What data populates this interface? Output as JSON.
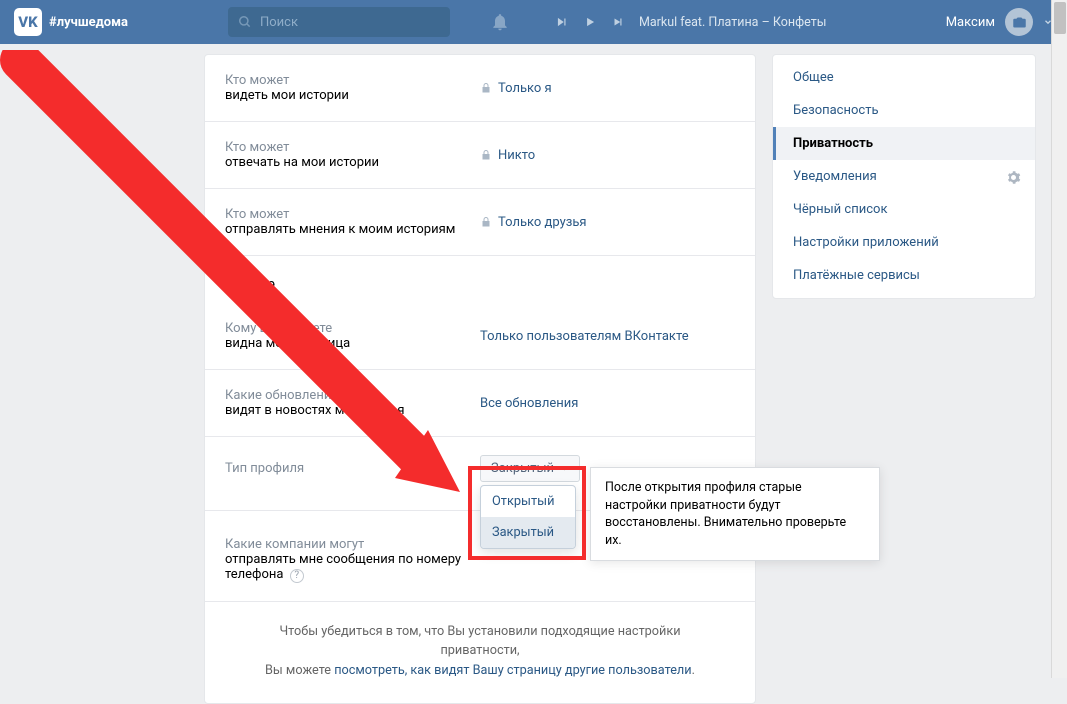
{
  "header": {
    "hashtag": "#лучшедома",
    "search_placeholder": "Поиск",
    "track": "Markul feat. Платина – Конфеты",
    "user": "Максим"
  },
  "rows": {
    "stories_view": {
      "q": "Кто может",
      "b": "видеть мои истории",
      "val": "Только я"
    },
    "stories_reply": {
      "q": "Кто может",
      "b": "отвечать на мои истории",
      "val": "Никто"
    },
    "stories_opinions": {
      "q": "Кто может",
      "b": "отправлять мнения к моим историям",
      "val": "Только друзья"
    },
    "section_other": "Прочее",
    "page_visible": {
      "q": "Кому в интернете",
      "b": "видна моя страница",
      "val": "Только пользователям ВКонтакте"
    },
    "updates": {
      "q": "Какие обновления",
      "b1": "видят",
      "b2": "в новостях мои друзья",
      "val": "Все обновления"
    },
    "profile_type": {
      "label": "Тип профиля",
      "selected": "Закрытый",
      "opt1": "Открытый",
      "opt2": "Закрытый"
    },
    "companies_msg": {
      "q": "Какие компании могут",
      "p1": "отправлять мне ",
      "b": "сообщения",
      "p2": " по номеру телефона"
    }
  },
  "tooltip": "После открытия профиля старые настройки приватности будут восстановлены. Внимательно проверьте их.",
  "sidebar": {
    "items": [
      "Общее",
      "Безопасность",
      "Приватность",
      "Уведомления",
      "Чёрный список",
      "Настройки приложений",
      "Платёжные сервисы"
    ]
  },
  "footer": {
    "p1": "Чтобы убедиться в том, что Вы установили подходящие настройки приватности,",
    "p2a": "Вы можете ",
    "link": "посмотреть, как видят Вашу страницу другие пользователи",
    "p2b": "."
  }
}
